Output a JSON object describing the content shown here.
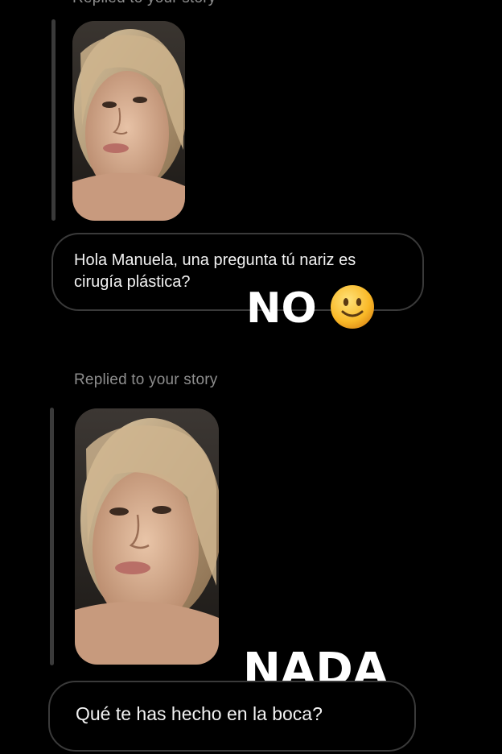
{
  "messages": [
    {
      "replied_label": "Replied to your story",
      "story_icon": "story-photo-icon",
      "text": "Hola Manuela, una pregunta tú nariz es cirugía plástica?"
    },
    {
      "replied_label": "Replied to your story",
      "story_icon": "story-photo-icon",
      "text": "Qué te has hecho en la boca?"
    }
  ],
  "overlays": {
    "answer_1": "NO",
    "answer_1_emoji": "slightly-smiling-face-icon",
    "answer_2": "NADA"
  },
  "colors": {
    "background": "#000000",
    "bubble_border": "#3a3a3a",
    "label": "#8e8e8e",
    "text": "#ffffff"
  }
}
